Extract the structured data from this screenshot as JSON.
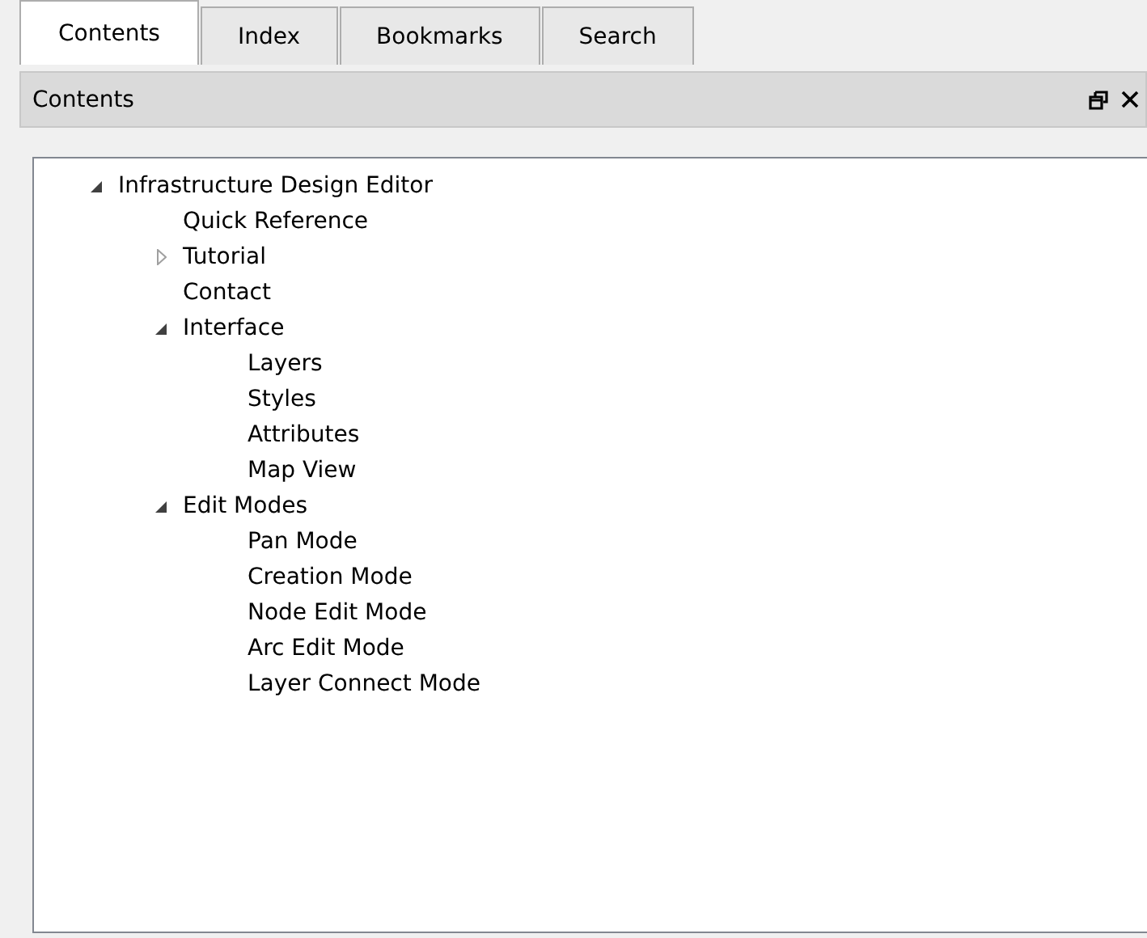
{
  "tabs": [
    {
      "label": "Contents",
      "selected": true
    },
    {
      "label": "Index",
      "selected": false
    },
    {
      "label": "Bookmarks",
      "selected": false
    },
    {
      "label": "Search",
      "selected": false
    }
  ],
  "panel": {
    "title": "Contents"
  },
  "tree": [
    {
      "label": "Infrastructure Design Editor",
      "expanded": true,
      "children": [
        {
          "label": "Quick Reference"
        },
        {
          "label": "Tutorial",
          "expanded": false
        },
        {
          "label": "Contact"
        },
        {
          "label": "Interface",
          "expanded": true,
          "children": [
            {
              "label": "Layers"
            },
            {
              "label": "Styles"
            },
            {
              "label": "Attributes"
            },
            {
              "label": "Map View"
            }
          ]
        },
        {
          "label": "Edit Modes",
          "expanded": true,
          "children": [
            {
              "label": "Pan Mode"
            },
            {
              "label": "Creation Mode"
            },
            {
              "label": "Node Edit Mode"
            },
            {
              "label": "Arc Edit Mode"
            },
            {
              "label": "Layer Connect Mode"
            }
          ]
        }
      ]
    }
  ]
}
